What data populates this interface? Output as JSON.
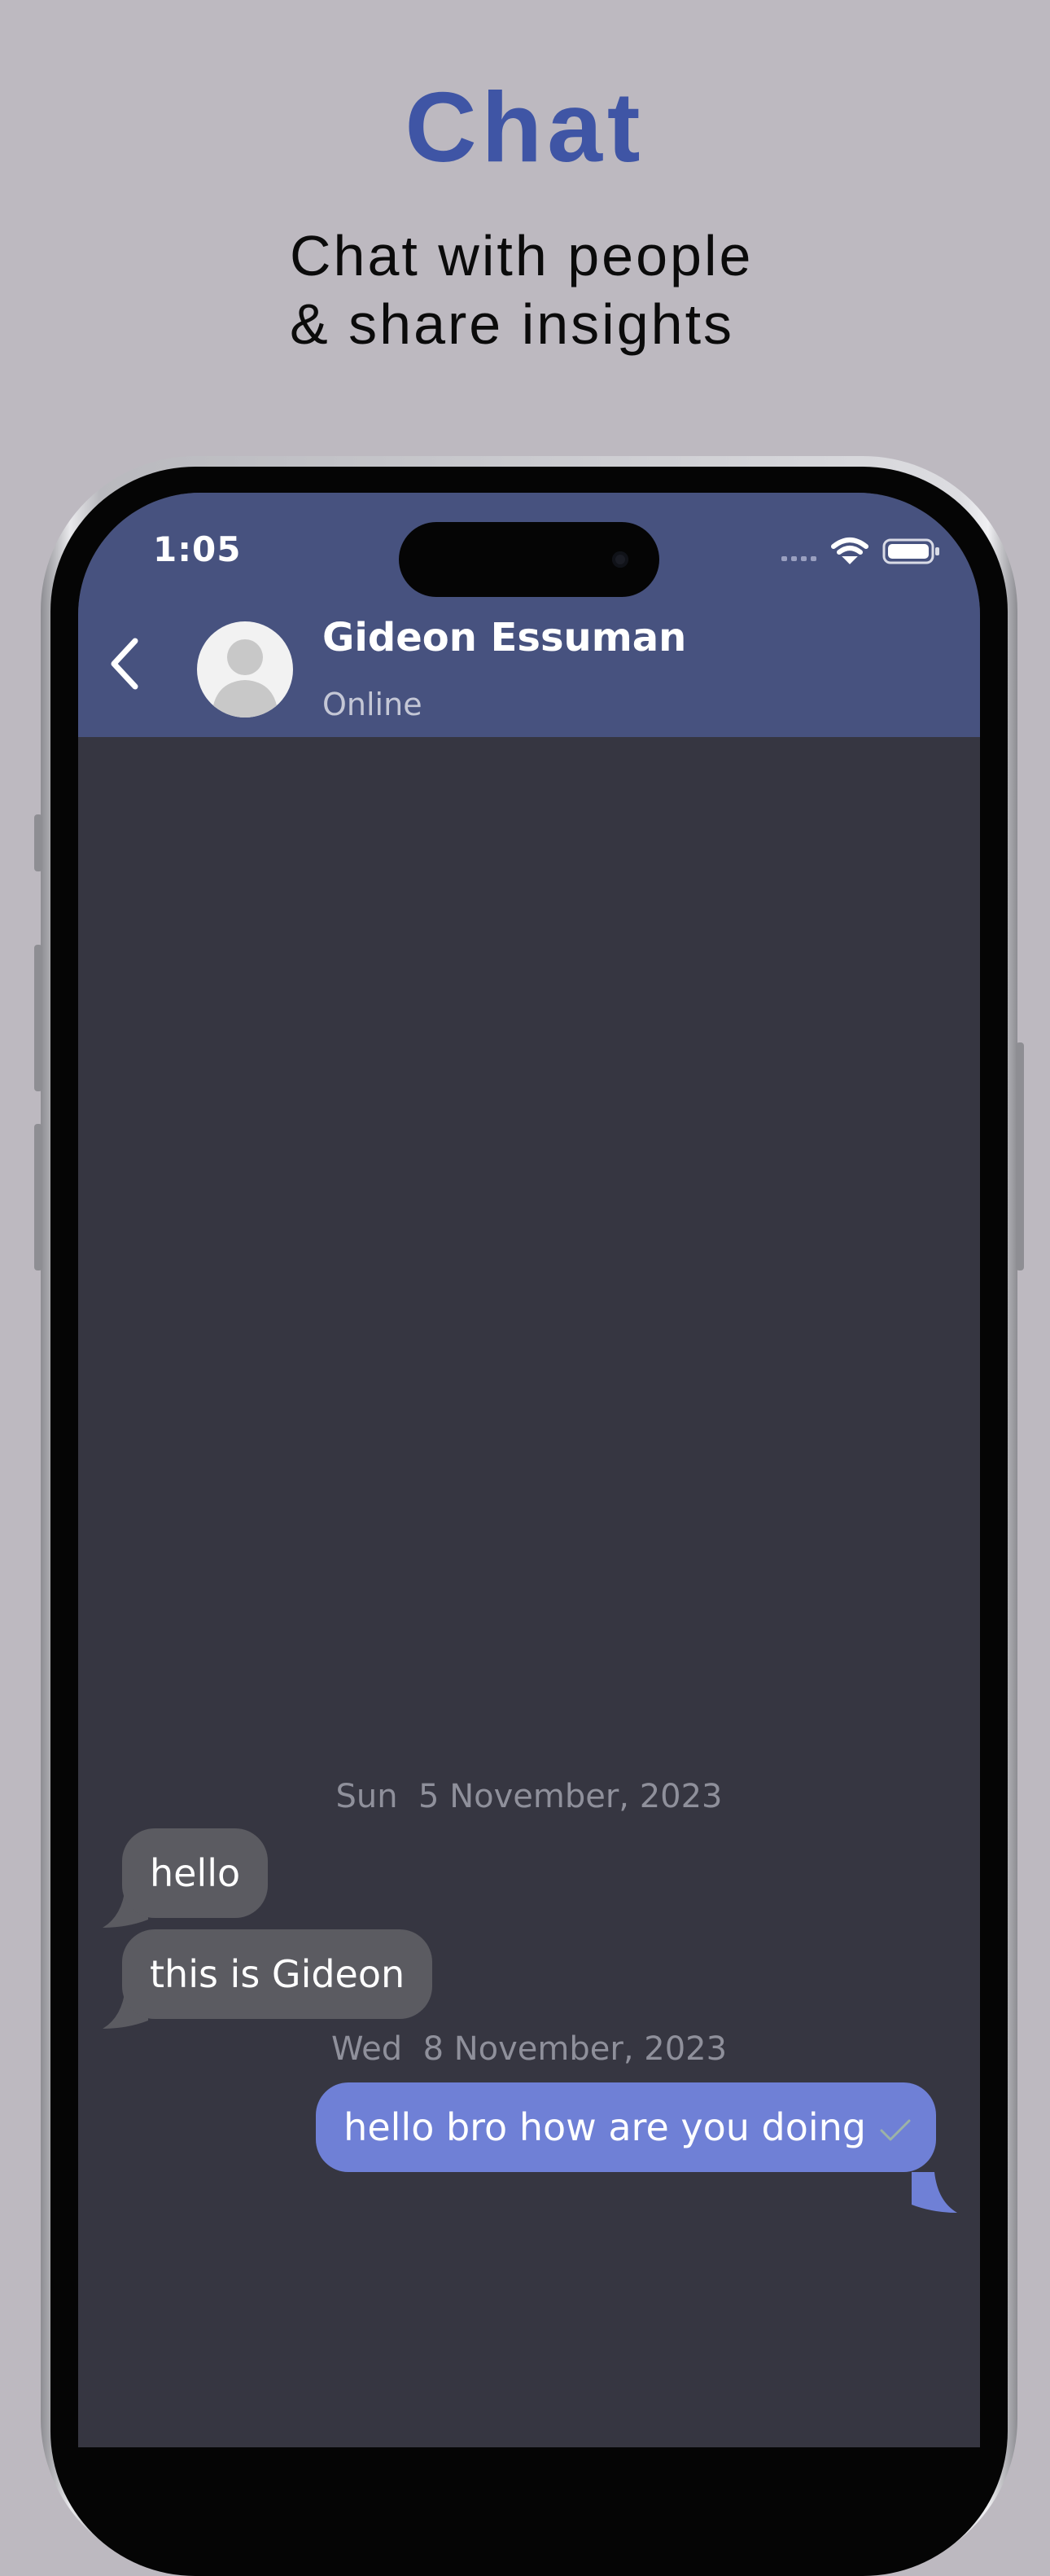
{
  "promo": {
    "title": "Chat",
    "subtitle_line1": "Chat with people",
    "subtitle_line2": "& share insights"
  },
  "status_bar": {
    "time": "1:05"
  },
  "header": {
    "contact_name": "Gideon Essuman",
    "contact_status": "Online"
  },
  "messages": [
    {
      "type": "date",
      "text": "Sun  5 November, 2023"
    },
    {
      "type": "incoming",
      "text": "hello"
    },
    {
      "type": "incoming",
      "text": "this is Gideon"
    },
    {
      "type": "date",
      "text": "Wed  8 November, 2023"
    },
    {
      "type": "outgoing",
      "text": "hello bro how are you doing",
      "status": "sent"
    }
  ],
  "colors": {
    "title": "#3f55a5",
    "header_bg": "#47527f",
    "chat_bg": "#363641",
    "incoming_bubble": "#5b5b61",
    "outgoing_bubble": "#6f80d6"
  }
}
